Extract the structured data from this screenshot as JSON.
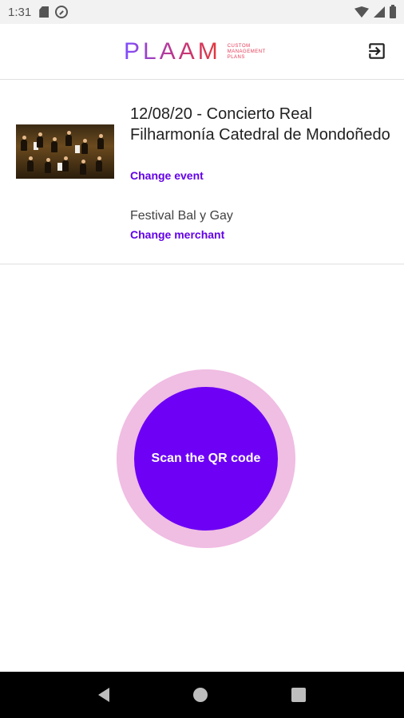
{
  "status_bar": {
    "time": "1:31",
    "icons": [
      "sd-card-icon",
      "sync-icon",
      "wifi-icon",
      "signal-icon",
      "battery-icon"
    ]
  },
  "header": {
    "logo_text": "PLAAM",
    "logo_tagline": [
      "CUSTOM",
      "MANAGEMENT",
      "PLANS"
    ],
    "logout_icon": "logout-icon"
  },
  "event": {
    "title": "12/08/20 - Concierto Real Filharmonía Catedral de Mondoñedo",
    "change_event_label": "Change event",
    "merchant": "Festival Bal y Gay",
    "change_merchant_label": "Change merchant",
    "thumbnail": "orchestra-photo"
  },
  "scan": {
    "label": "Scan the QR code"
  },
  "colors": {
    "accent": "#6200ea",
    "scan_inner": "#6d00f5",
    "scan_outer": "#f0bde3"
  },
  "nav_bar": {
    "icons": [
      "back-icon",
      "home-icon",
      "recents-icon"
    ]
  }
}
